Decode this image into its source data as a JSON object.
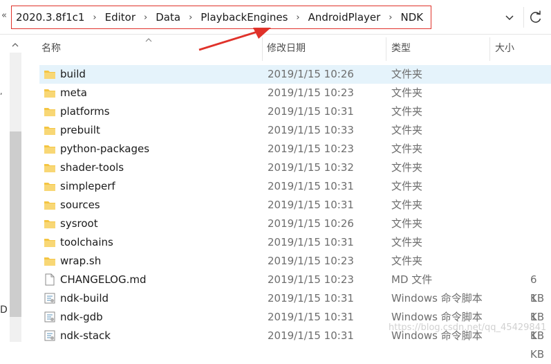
{
  "address_bar": {
    "back_chevrons": "«",
    "crumbs": [
      "2020.3.8f1c1",
      "Editor",
      "Data",
      "PlaybackEngines",
      "AndroidPlayer",
      "NDK"
    ],
    "separator": "›"
  },
  "left_pane": {
    "mark": ",",
    "letter": "D"
  },
  "columns": {
    "name": "名称",
    "date": "修改日期",
    "type": "类型",
    "size": "大小"
  },
  "files": [
    {
      "name": "build",
      "date": "2019/1/15 10:26",
      "type": "文件夹",
      "size": "",
      "icon": "folder-icon",
      "selected": true
    },
    {
      "name": "meta",
      "date": "2019/1/15 10:23",
      "type": "文件夹",
      "size": "",
      "icon": "folder-icon"
    },
    {
      "name": "platforms",
      "date": "2019/1/15 10:31",
      "type": "文件夹",
      "size": "",
      "icon": "folder-icon"
    },
    {
      "name": "prebuilt",
      "date": "2019/1/15 10:33",
      "type": "文件夹",
      "size": "",
      "icon": "folder-icon"
    },
    {
      "name": "python-packages",
      "date": "2019/1/15 10:23",
      "type": "文件夹",
      "size": "",
      "icon": "folder-icon"
    },
    {
      "name": "shader-tools",
      "date": "2019/1/15 10:32",
      "type": "文件夹",
      "size": "",
      "icon": "folder-icon"
    },
    {
      "name": "simpleperf",
      "date": "2019/1/15 10:31",
      "type": "文件夹",
      "size": "",
      "icon": "folder-icon"
    },
    {
      "name": "sources",
      "date": "2019/1/15 10:31",
      "type": "文件夹",
      "size": "",
      "icon": "folder-icon"
    },
    {
      "name": "sysroot",
      "date": "2019/1/15 10:26",
      "type": "文件夹",
      "size": "",
      "icon": "folder-icon"
    },
    {
      "name": "toolchains",
      "date": "2019/1/15 10:31",
      "type": "文件夹",
      "size": "",
      "icon": "folder-icon"
    },
    {
      "name": "wrap.sh",
      "date": "2019/1/15 10:23",
      "type": "文件夹",
      "size": "",
      "icon": "folder-icon"
    },
    {
      "name": "CHANGELOG.md",
      "date": "2019/1/15 10:23",
      "type": "MD 文件",
      "size": "6 KB",
      "icon": "document-icon"
    },
    {
      "name": "ndk-build",
      "date": "2019/1/15 10:31",
      "type": "Windows 命令脚本",
      "size": "1 KB",
      "icon": "script-icon"
    },
    {
      "name": "ndk-gdb",
      "date": "2019/1/15 10:31",
      "type": "Windows 命令脚本",
      "size": "1 KB",
      "icon": "script-icon"
    },
    {
      "name": "ndk-stack",
      "date": "2019/1/15 10:31",
      "type": "Windows 命令脚本",
      "size": "1 KB",
      "icon": "script-icon"
    }
  ],
  "watermark": "https://blog.csdn.net/qq_45429841",
  "colors": {
    "annotation": "#e0322a",
    "selected_row": "#e5f3fb",
    "folder": "#f4c542"
  }
}
